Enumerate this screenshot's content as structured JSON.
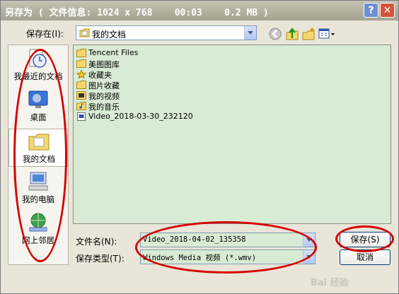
{
  "window": {
    "title": "另存为 ( 文件信息: 1024 x 768    00:03    0.2 MB )"
  },
  "titlebar": {
    "help_glyph": "?",
    "close_glyph": "✕"
  },
  "save_in": {
    "label": "保存在(I):",
    "value": "我的文档"
  },
  "nav_icons": [
    "back-icon",
    "up-folder-icon",
    "new-folder-icon",
    "view-menu-icon"
  ],
  "places": [
    {
      "label": "我最近的文档",
      "icon": "recent-documents-icon"
    },
    {
      "label": "桌面",
      "icon": "desktop-icon"
    },
    {
      "label": "我的文档",
      "icon": "my-documents-icon",
      "selected": true
    },
    {
      "label": "我的电脑",
      "icon": "my-computer-icon"
    },
    {
      "label": "网上邻居",
      "icon": "network-places-icon"
    }
  ],
  "files": [
    {
      "name": "Tencent Files",
      "icon": "folder-icon"
    },
    {
      "name": "美图图库",
      "icon": "folder-icon"
    },
    {
      "name": "收藏夹",
      "icon": "favorites-star-icon"
    },
    {
      "name": "图片收藏",
      "icon": "folder-icon"
    },
    {
      "name": "我的视频",
      "icon": "video-folder-icon"
    },
    {
      "name": "我的音乐",
      "icon": "music-folder-icon"
    },
    {
      "name": "Video_2018-03-30_232120",
      "icon": "video-file-icon"
    }
  ],
  "filename": {
    "label": "文件名(N):",
    "value": "Video_2018-04-02_135358"
  },
  "filetype": {
    "label": "保存类型(T):",
    "value": "Windows Media 视频 (*.wmv)"
  },
  "buttons": {
    "save": "保存(S)",
    "cancel": "取消"
  },
  "watermark": "Bai 经验",
  "colors": {
    "annotation_red": "#d40000",
    "list_background": "#d8ebd4"
  }
}
